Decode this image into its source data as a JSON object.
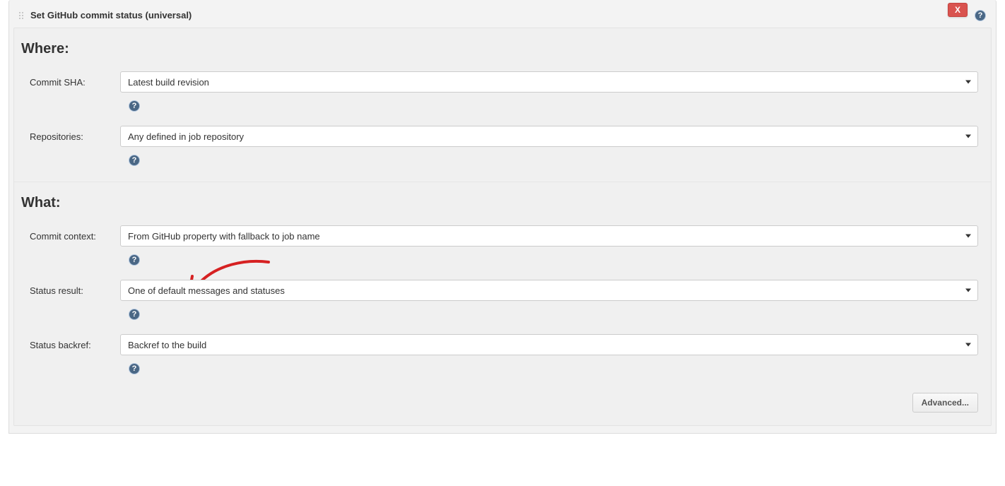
{
  "section": {
    "title": "Set GitHub commit status (universal)",
    "remove_label": "X",
    "advanced_label": "Advanced..."
  },
  "where": {
    "heading": "Where:",
    "commit_sha": {
      "label": "Commit SHA:",
      "value": "Latest build revision"
    },
    "repositories": {
      "label": "Repositories:",
      "value": "Any defined in job repository"
    }
  },
  "what": {
    "heading": "What:",
    "commit_context": {
      "label": "Commit context:",
      "value": "From GitHub property with fallback to job name"
    },
    "status_result": {
      "label": "Status result:",
      "value": "One of default messages and statuses"
    },
    "status_backref": {
      "label": "Status backref:",
      "value": "Backref to the build"
    }
  },
  "icons": {
    "help_glyph": "?"
  }
}
